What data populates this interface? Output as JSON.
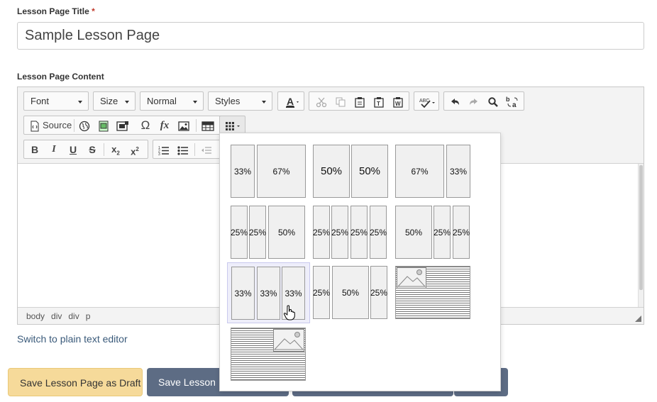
{
  "form": {
    "title_label": "Lesson Page Title",
    "required_mark": "*",
    "title_value": "Sample Lesson Page",
    "content_label": "Lesson Page Content"
  },
  "toolbar": {
    "font_label": "Font",
    "size_label": "Size",
    "format_label": "Normal",
    "styles_label": "Styles",
    "source_label": "Source",
    "icons": [
      "text-color-icon",
      "cut-icon",
      "copy-icon",
      "paste-icon",
      "paste-text-icon",
      "paste-word-icon",
      "spellcheck-icon",
      "undo-icon",
      "redo-icon",
      "find-icon",
      "replace-icon",
      "source-icon",
      "link-icon",
      "media-icon",
      "iframe-icon",
      "special-char-icon",
      "formula-icon",
      "image-icon",
      "table-icon",
      "templates-icon",
      "bold-icon",
      "italic-icon",
      "underline-icon",
      "strikethrough-icon",
      "subscript-icon",
      "superscript-icon",
      "numbered-list-icon",
      "bulleted-list-icon",
      "outdent-icon"
    ]
  },
  "status_path": [
    "body",
    "div",
    "div",
    "p"
  ],
  "switch_link": "Switch to plain text editor",
  "buttons": {
    "draft": "Save Lesson Page as Draft",
    "save2": "Save Lesson P",
    "save3": "",
    "save4": ""
  },
  "templates": {
    "t1": [
      "33%",
      "67%"
    ],
    "t2": [
      "50%",
      "50%"
    ],
    "t3": [
      "67%",
      "33%"
    ],
    "t4": [
      "25%",
      "25%",
      "50%"
    ],
    "t5": [
      "25%",
      "25%",
      "25%",
      "25%"
    ],
    "t6": [
      "50%",
      "25%",
      "25%"
    ],
    "t7": [
      "33%",
      "33%",
      "33%"
    ],
    "t8": [
      "25%",
      "50%",
      "25%"
    ]
  },
  "colors": {
    "draft_button": "#f6da9a",
    "save_button": "#5d6c84",
    "link": "#3a5a7a",
    "required": "#c0392b"
  }
}
